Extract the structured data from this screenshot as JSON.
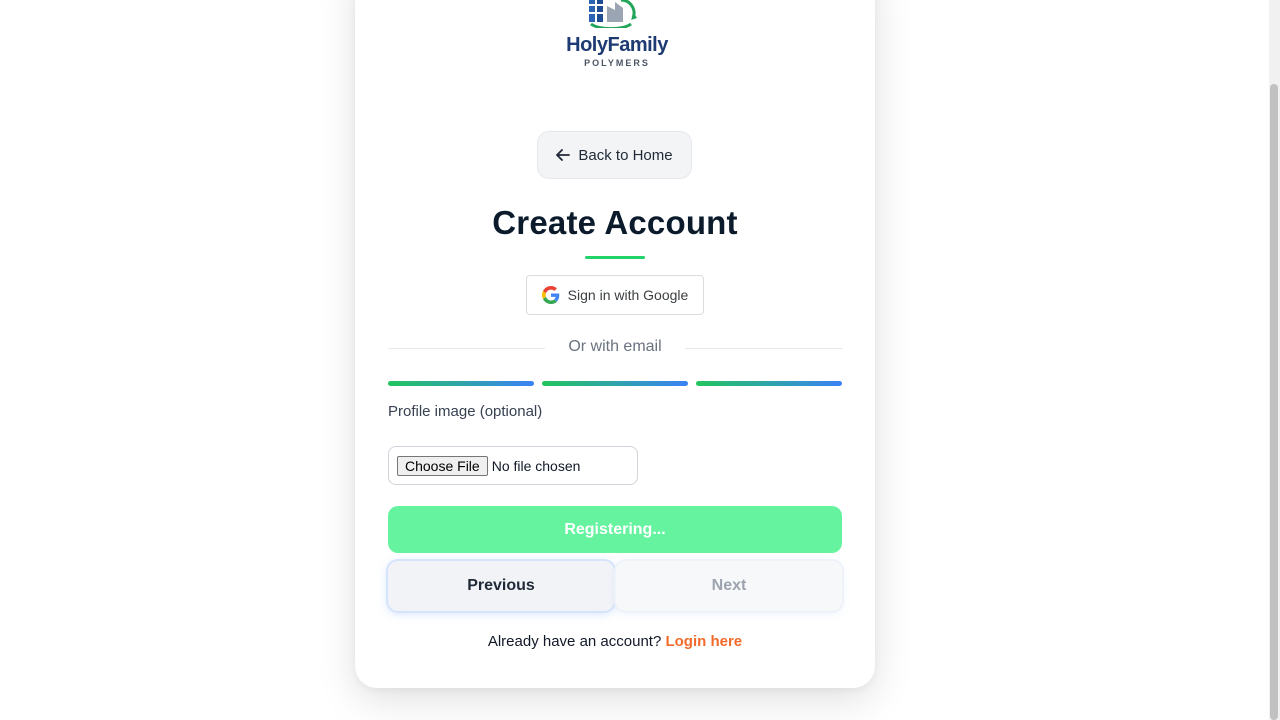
{
  "brand": {
    "name": "HolyFamily",
    "tagline": "POLYMERS",
    "logo_icon": "factory-cloud-recycle-icon",
    "primary_color": "#1e3a72",
    "accent_color": "#22c55e"
  },
  "nav": {
    "back_label": "Back to Home",
    "back_icon": "arrow-left-icon"
  },
  "form": {
    "title": "Create Account",
    "google_label": "Sign in with Google",
    "divider_text": "Or with email",
    "steps_total": 3,
    "steps_completed": 3,
    "profile_label": "Profile image (optional)",
    "file_button_label": "Choose File",
    "file_status": "No file chosen",
    "submit_label": "Registering...",
    "previous_label": "Previous",
    "next_label": "Next",
    "login_prompt": "Already have an account?",
    "login_link": "Login here"
  },
  "colors": {
    "submit": "#66f3a0",
    "link": "#f26b2a",
    "title_underline": "#22d36a"
  }
}
